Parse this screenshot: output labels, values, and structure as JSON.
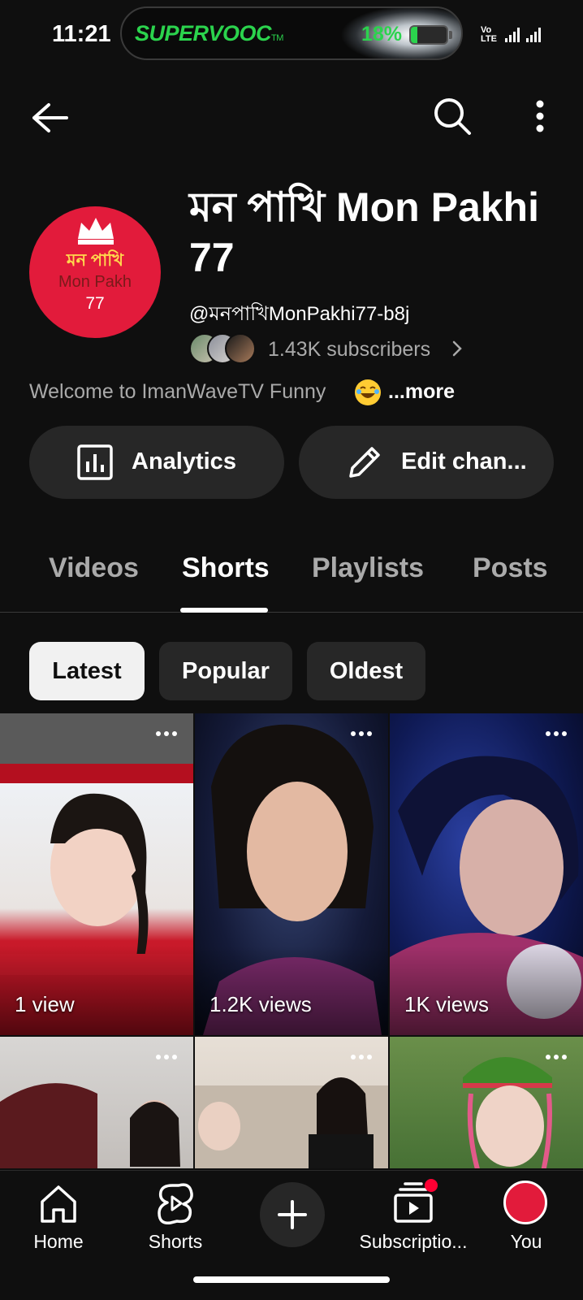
{
  "status_bar": {
    "time": "11:21",
    "charging_brand": "SUPERVOOC",
    "charging_brand_tm": "TM",
    "battery_percent": "18%",
    "battery_level": 0.18,
    "network_label": "Vo LTE",
    "accent_color": "#2bd34d"
  },
  "header": {
    "back_icon": "arrow-left-icon",
    "search_icon": "search-icon",
    "more_icon": "more-vertical-icon"
  },
  "channel": {
    "avatar_line_1": "মন পাখি",
    "avatar_line_2": "Mon Pakh",
    "avatar_line_3": "77",
    "avatar_color": "#e21b3b",
    "title": "মন পাখি Mon Pakhi 77",
    "handle": "@মনপাখিMonPakhi77-b8j",
    "subscribers": "1.43K subscribers",
    "description": "Welcome to ImanWaveTV Funny",
    "description_emoji": "laughing-face-emoji",
    "more_label": "...more"
  },
  "actions": {
    "analytics_label": "Analytics",
    "edit_label": "Edit chan..."
  },
  "tabs": [
    {
      "label": "Videos",
      "active": false
    },
    {
      "label": "Shorts",
      "active": true
    },
    {
      "label": "Playlists",
      "active": false
    },
    {
      "label": "Posts",
      "active": false
    }
  ],
  "chips": [
    {
      "label": "Latest",
      "active": true
    },
    {
      "label": "Popular",
      "active": false
    },
    {
      "label": "Oldest",
      "active": false
    }
  ],
  "shorts": [
    {
      "views": "1 view"
    },
    {
      "views": "1.2K views"
    },
    {
      "views": "1K views"
    },
    {
      "views": ""
    },
    {
      "views": ""
    },
    {
      "views": ""
    }
  ],
  "bottom_nav": {
    "home": "Home",
    "shorts": "Shorts",
    "create_icon": "plus-icon",
    "subscriptions": "Subscriptio...",
    "you": "You"
  }
}
